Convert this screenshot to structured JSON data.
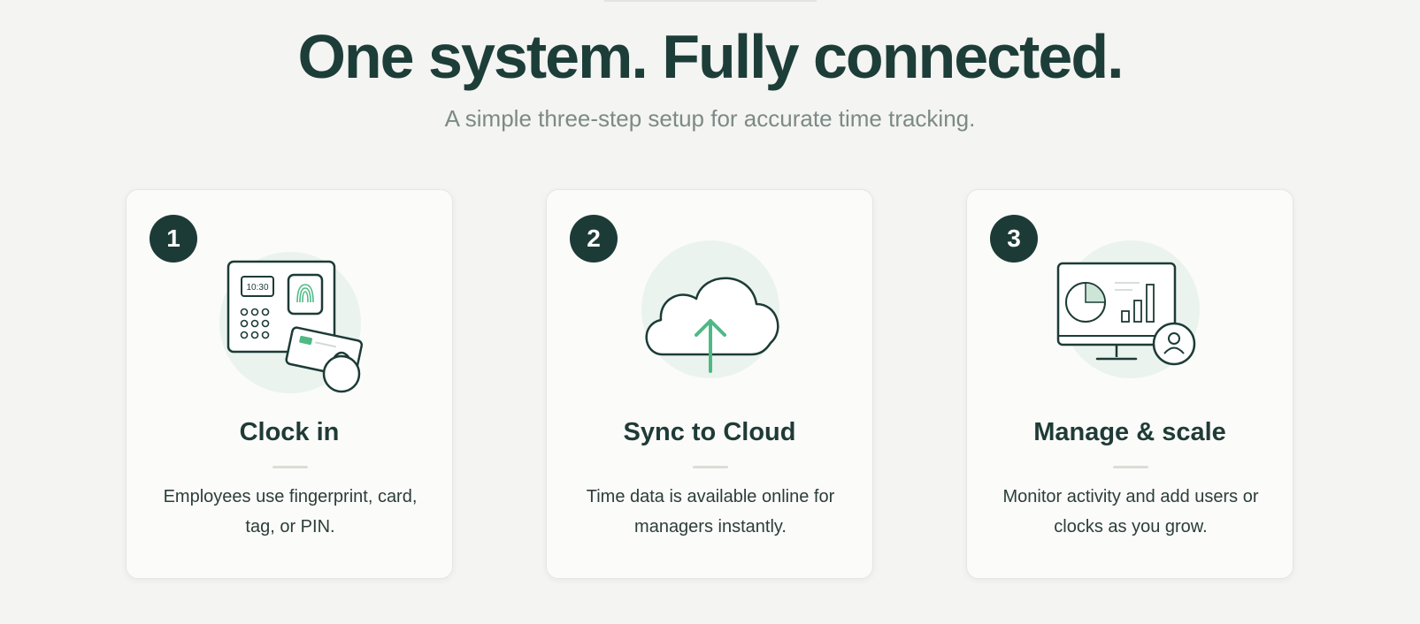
{
  "headline": "One system. Fully connected.",
  "subheadline": "A simple three-step setup for accurate time tracking.",
  "colors": {
    "background": "#f4f4f2",
    "card": "#fbfbfa",
    "dark_green": "#1d3b36",
    "accent_green": "#4fb985",
    "subtle_mint": "#eaf3ee",
    "muted_text": "#7c8a87"
  },
  "steps": [
    {
      "number": "1",
      "title": "Clock in",
      "description": "Employees use fingerprint, card, tag, or PIN.",
      "icon": "time-clock-terminal-icon",
      "clock_display": "10:30"
    },
    {
      "number": "2",
      "title": "Sync to Cloud",
      "description": "Time data is available online for managers instantly.",
      "icon": "cloud-upload-icon"
    },
    {
      "number": "3",
      "title": "Manage & scale",
      "description": "Monitor activity and add users or clocks as you grow.",
      "icon": "dashboard-monitor-icon"
    }
  ]
}
